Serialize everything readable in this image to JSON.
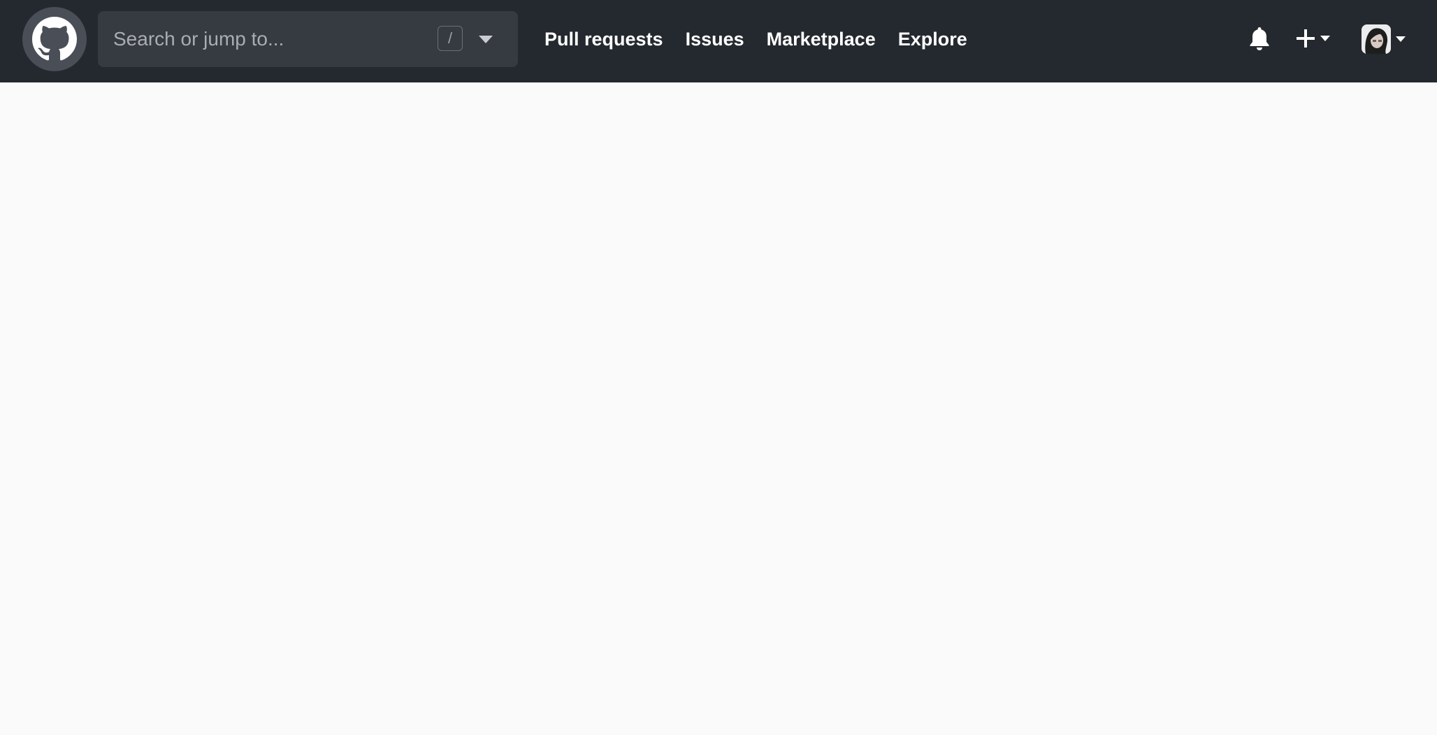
{
  "header": {
    "logo_icon": "github-mark-icon",
    "search": {
      "placeholder": "Search or jump to...",
      "value": "",
      "shortcut_key": "/"
    },
    "nav": [
      {
        "label": "Pull requests"
      },
      {
        "label": "Issues"
      },
      {
        "label": "Marketplace"
      },
      {
        "label": "Explore"
      }
    ],
    "icons": {
      "notifications": "bell-icon",
      "create": "plus-icon",
      "create_menu": "caret-down-icon",
      "profile_menu": "caret-down-icon"
    }
  },
  "colors": {
    "header_bg": "#24292f",
    "search_bg": "#363a41",
    "page_bg": "#fafafa",
    "nav_text": "#ffffff"
  }
}
